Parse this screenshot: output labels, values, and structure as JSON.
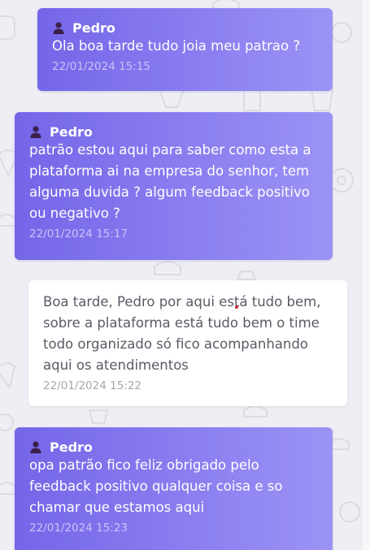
{
  "messages": [
    {
      "sender": "Pedro",
      "text": "Ola boa tarde tudo joia meu patrao ?",
      "time": "22/01/2024 15:15"
    },
    {
      "sender": "Pedro",
      "text": "patrão estou aqui para saber como esta a plataforma ai na empresa do senhor, tem alguma duvida ? algum feedback positivo ou negativo ?",
      "time": "22/01/2024 15:17"
    },
    {
      "text": "Boa tarde, Pedro por aqui está tudo bem, sobre a plataforma está tudo bem o time todo organizado só fico acompanhando aqui os atendimentos",
      "time": "22/01/2024 15:22"
    },
    {
      "sender": "Pedro",
      "text": "opa patrão fico feliz obrigado pelo feedback positivo qualquer coisa e so chamar que estamos aqui",
      "time": "22/01/2024 15:23"
    }
  ],
  "icons": {
    "sender": "user-icon"
  },
  "colors": {
    "incoming_start": "#7466e8",
    "incoming_end": "#9b93f5",
    "outgoing": "#ffffff",
    "background": "#efeef4"
  }
}
